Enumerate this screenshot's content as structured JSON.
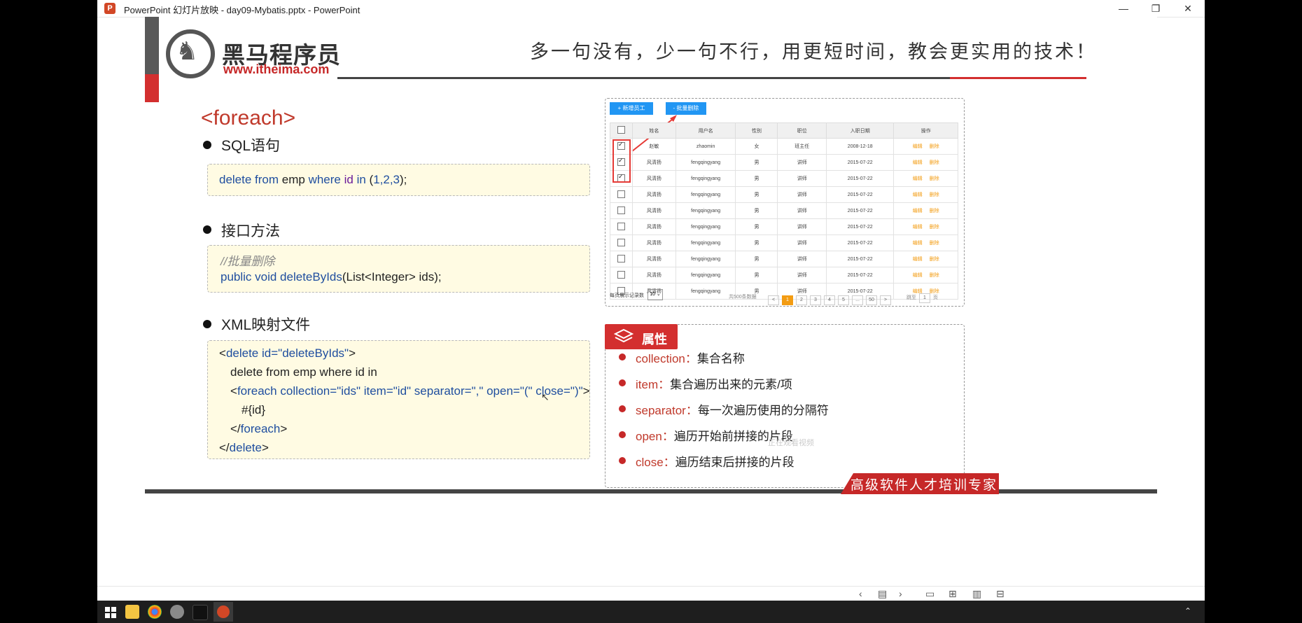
{
  "window": {
    "title": "PowerPoint 幻灯片放映 - day09-Mybatis.pptx - PowerPoint",
    "app_icon": "P"
  },
  "slide": {
    "logo": {
      "cn": "黑马程序员",
      "url": "www.itheima.com"
    },
    "slogan": "多一句没有，少一句不行，用更短时间，教会更实用的技术！",
    "title": "<foreach>",
    "sections": {
      "sql": {
        "heading": "SQL语句",
        "code": {
          "p1": "delete from",
          "p2": " emp ",
          "p3": "where",
          "p4": " id ",
          "p5": "in",
          "p6": " (",
          "p7": "1,2,3",
          "p8": ");"
        }
      },
      "iface": {
        "heading": "接口方法",
        "comment": "//批量删除",
        "code": {
          "p1": "public void",
          "p2": " deleteByIds",
          "p3": "(List<Integer>  ids);"
        }
      },
      "xml": {
        "heading": "XML映射文件",
        "l1": {
          "a": "<",
          "b": "delete",
          "c": " id=",
          "d": "\"deleteByIds\"",
          "e": ">"
        },
        "l2": "delete from emp where id in",
        "l3": {
          "a": "<",
          "b": "foreach",
          "c": " collection=",
          "d": "\"ids\"",
          "e": " item=",
          "f": "\"id\"",
          "g": " separator=",
          "h": "\",\"",
          "i": " open=",
          "j": "\"(\"",
          "k": " close=",
          "l": "\")\"",
          "m": ">"
        },
        "l4": "#{id}",
        "l5": {
          "a": "</",
          "b": "foreach",
          "c": ">"
        },
        "l6": {
          "a": "</",
          "b": "delete",
          "c": ">"
        }
      }
    },
    "table_panel": {
      "add_button": "+ 新增员工",
      "batch_delete_button": "- 批量删除",
      "headers": [
        "",
        "姓名",
        "用户名",
        "性别",
        "职位",
        "入职日期",
        "操作"
      ],
      "rows": [
        [
          "赵敏",
          "zhaomin",
          "女",
          "班主任",
          "2008-12-18",
          true
        ],
        [
          "风清扬",
          "fengqingyang",
          "男",
          "讲师",
          "2015-07-22",
          true
        ],
        [
          "风清扬",
          "fengqingyang",
          "男",
          "讲师",
          "2015-07-22",
          true
        ],
        [
          "风清扬",
          "fengqingyang",
          "男",
          "讲师",
          "2015-07-22",
          false
        ],
        [
          "风清扬",
          "fengqingyang",
          "男",
          "讲师",
          "2015-07-22",
          false
        ],
        [
          "风清扬",
          "fengqingyang",
          "男",
          "讲师",
          "2015-07-22",
          false
        ],
        [
          "风清扬",
          "fengqingyang",
          "男",
          "讲师",
          "2015-07-22",
          false
        ],
        [
          "风清扬",
          "fengqingyang",
          "男",
          "讲师",
          "2015-07-22",
          false
        ],
        [
          "风清扬",
          "fengqingyang",
          "男",
          "讲师",
          "2015-07-22",
          false
        ],
        [
          "风清扬",
          "fengqingyang",
          "男",
          "讲师",
          "2015-07-22",
          false
        ]
      ],
      "op_edit": "编辑",
      "op_delete": "删除",
      "page_size_label": "每页展示记录数",
      "page_size": "10",
      "total": "共500条数据",
      "pages": [
        "<",
        "1",
        "2",
        "3",
        "4",
        "5",
        "...",
        "50",
        ">"
      ],
      "jump_label": "跳至",
      "jump_value": "1",
      "page_unit": "页"
    },
    "attributes": {
      "tab_label": "属性",
      "items": [
        {
          "key": "collection：",
          "desc": "集合名称"
        },
        {
          "key": "item：",
          "desc": "集合遍历出来的元素/项"
        },
        {
          "key": "separator：",
          "desc": "每一次遍历使用的分隔符"
        },
        {
          "key": "open：",
          "desc": "遍历开始前拼接的片段"
        },
        {
          "key": "close：",
          "desc": "遍历结束后拼接的片段"
        }
      ],
      "watermark": "正在观看视频"
    },
    "footer": "高级软件人才培训专家"
  },
  "statusbar": {
    "prev": "‹",
    "next": "›"
  }
}
